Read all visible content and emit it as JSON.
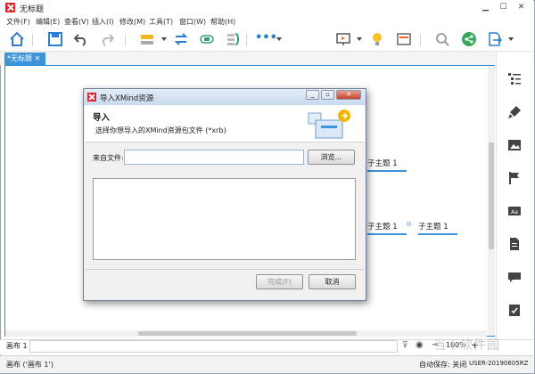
{
  "window": {
    "title": "无标题"
  },
  "menu": [
    "文件(F)",
    "编辑(E)",
    "查看(V)",
    "插入(I)",
    "修改(M)",
    "工具(T)",
    "窗口(W)",
    "帮助(H)"
  ],
  "toolbar": {
    "icons": [
      "home-icon",
      "save-icon",
      "undo-icon",
      "redo-icon",
      "topic-insert-icon",
      "relationship-icon",
      "boundary-icon",
      "summary-icon",
      "more-icon",
      "presentation-icon",
      "idea-icon",
      "layout-icon",
      "search-icon",
      "share-icon",
      "export-icon"
    ]
  },
  "tab": {
    "label": "*无标题 ✕"
  },
  "canvas": {
    "topics": [
      "子主题 1",
      "子主题 1",
      "子主题 1"
    ]
  },
  "right_panel": {
    "icons": [
      "outline-icon",
      "format-icon",
      "image-icon",
      "marker-icon",
      "label-icon",
      "notes-icon",
      "comments-icon",
      "task-icon"
    ]
  },
  "dialog": {
    "title": "导入XMind资源",
    "heading": "导入",
    "description": "选择你想导入的XMind资源包文件 (*xrb)",
    "from_label": "来自文件:",
    "file_value": "",
    "browse_label": "浏览...",
    "finish_label": "完成(F)",
    "cancel_label": "取消"
  },
  "sheetbar": {
    "sheet": "画布 1",
    "zoom": "100%",
    "minus": "−",
    "plus": "+"
  },
  "statusbar": {
    "left": "画布 ('画布 1')",
    "autosave": "自动保存: 关闭",
    "user": "USER-20190605RZ"
  },
  "watermark": "当下软件园",
  "colors": {
    "accent": "#3f93d8",
    "brand": "#d9232e"
  }
}
